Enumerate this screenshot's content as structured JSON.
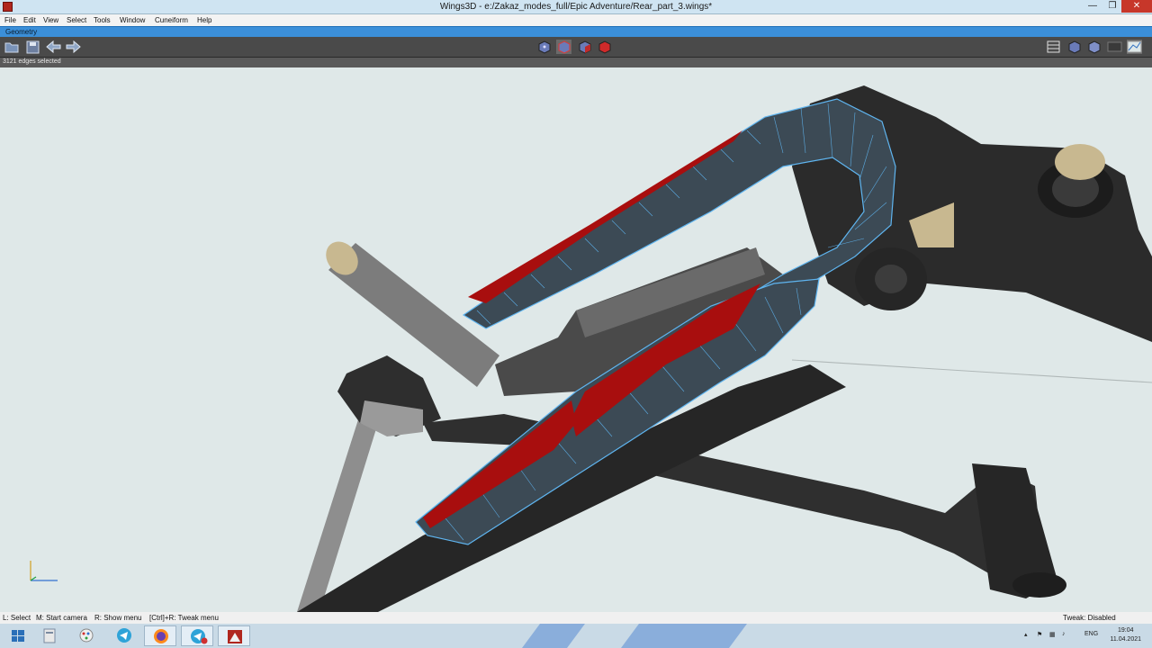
{
  "window": {
    "title": "Wings3D - e:/Zakaz_modes_full/Epic Adventure/Rear_part_3.wings*",
    "minimize": "—",
    "maximize": "❐",
    "close": "✕"
  },
  "menu": [
    "File",
    "Edit",
    "View",
    "Select",
    "Tools",
    "Window",
    "Cuneiform",
    "Help"
  ],
  "geometry_tab": "Geometry",
  "status": "3121 edges selected",
  "hints": {
    "left": "L: Select",
    "middle": "M: Start camera",
    "right": "R: Show menu",
    "ctrl": "[Ctrl]+R: Tweak menu",
    "tweak": "Tweak: Disabled"
  },
  "toolbar": {
    "left": [
      "open-icon",
      "save-icon",
      "undo-icon",
      "redo-icon"
    ],
    "select_modes": [
      "vertex-mode-icon",
      "edge-mode-icon",
      "face-mode-icon",
      "body-mode-icon"
    ],
    "right": [
      "wireframe-icon",
      "smooth-shaded-icon",
      "flat-shaded-icon",
      "groundplane-icon",
      "perspective-icon"
    ]
  },
  "taskbar": {
    "apps": [
      "start-icon",
      "file-explorer-icon",
      "paint-icon",
      "telegram-icon",
      "firefox-icon",
      "telegram-badge-icon",
      "wings3d-icon"
    ],
    "tray_lang": "ENG",
    "time": "19:04",
    "date": "11.04.2021"
  },
  "colors": {
    "selection": "#5fb5f0",
    "frame": "#2f2f2f",
    "decal": "#b01010",
    "viewport_bg": "#dfe8e8"
  }
}
